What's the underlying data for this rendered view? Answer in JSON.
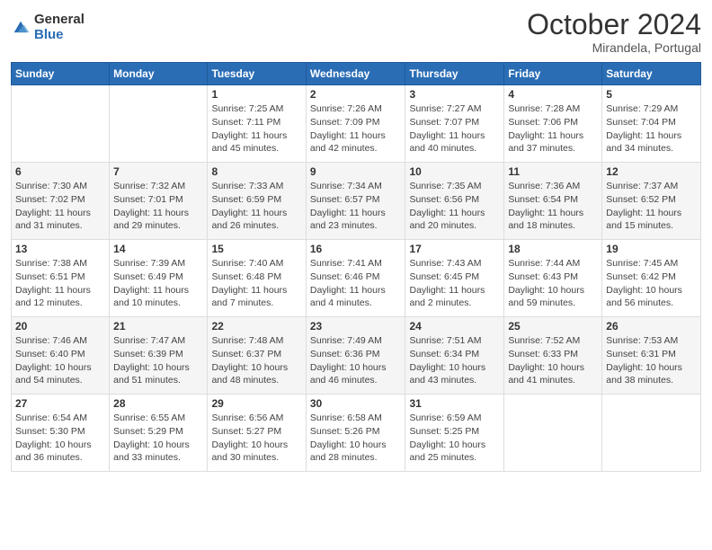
{
  "header": {
    "logo_general": "General",
    "logo_blue": "Blue",
    "month_title": "October 2024",
    "location": "Mirandela, Portugal"
  },
  "days_of_week": [
    "Sunday",
    "Monday",
    "Tuesday",
    "Wednesday",
    "Thursday",
    "Friday",
    "Saturday"
  ],
  "weeks": [
    [
      {
        "day": "",
        "info": ""
      },
      {
        "day": "",
        "info": ""
      },
      {
        "day": "1",
        "info": "Sunrise: 7:25 AM\nSunset: 7:11 PM\nDaylight: 11 hours and 45 minutes."
      },
      {
        "day": "2",
        "info": "Sunrise: 7:26 AM\nSunset: 7:09 PM\nDaylight: 11 hours and 42 minutes."
      },
      {
        "day": "3",
        "info": "Sunrise: 7:27 AM\nSunset: 7:07 PM\nDaylight: 11 hours and 40 minutes."
      },
      {
        "day": "4",
        "info": "Sunrise: 7:28 AM\nSunset: 7:06 PM\nDaylight: 11 hours and 37 minutes."
      },
      {
        "day": "5",
        "info": "Sunrise: 7:29 AM\nSunset: 7:04 PM\nDaylight: 11 hours and 34 minutes."
      }
    ],
    [
      {
        "day": "6",
        "info": "Sunrise: 7:30 AM\nSunset: 7:02 PM\nDaylight: 11 hours and 31 minutes."
      },
      {
        "day": "7",
        "info": "Sunrise: 7:32 AM\nSunset: 7:01 PM\nDaylight: 11 hours and 29 minutes."
      },
      {
        "day": "8",
        "info": "Sunrise: 7:33 AM\nSunset: 6:59 PM\nDaylight: 11 hours and 26 minutes."
      },
      {
        "day": "9",
        "info": "Sunrise: 7:34 AM\nSunset: 6:57 PM\nDaylight: 11 hours and 23 minutes."
      },
      {
        "day": "10",
        "info": "Sunrise: 7:35 AM\nSunset: 6:56 PM\nDaylight: 11 hours and 20 minutes."
      },
      {
        "day": "11",
        "info": "Sunrise: 7:36 AM\nSunset: 6:54 PM\nDaylight: 11 hours and 18 minutes."
      },
      {
        "day": "12",
        "info": "Sunrise: 7:37 AM\nSunset: 6:52 PM\nDaylight: 11 hours and 15 minutes."
      }
    ],
    [
      {
        "day": "13",
        "info": "Sunrise: 7:38 AM\nSunset: 6:51 PM\nDaylight: 11 hours and 12 minutes."
      },
      {
        "day": "14",
        "info": "Sunrise: 7:39 AM\nSunset: 6:49 PM\nDaylight: 11 hours and 10 minutes."
      },
      {
        "day": "15",
        "info": "Sunrise: 7:40 AM\nSunset: 6:48 PM\nDaylight: 11 hours and 7 minutes."
      },
      {
        "day": "16",
        "info": "Sunrise: 7:41 AM\nSunset: 6:46 PM\nDaylight: 11 hours and 4 minutes."
      },
      {
        "day": "17",
        "info": "Sunrise: 7:43 AM\nSunset: 6:45 PM\nDaylight: 11 hours and 2 minutes."
      },
      {
        "day": "18",
        "info": "Sunrise: 7:44 AM\nSunset: 6:43 PM\nDaylight: 10 hours and 59 minutes."
      },
      {
        "day": "19",
        "info": "Sunrise: 7:45 AM\nSunset: 6:42 PM\nDaylight: 10 hours and 56 minutes."
      }
    ],
    [
      {
        "day": "20",
        "info": "Sunrise: 7:46 AM\nSunset: 6:40 PM\nDaylight: 10 hours and 54 minutes."
      },
      {
        "day": "21",
        "info": "Sunrise: 7:47 AM\nSunset: 6:39 PM\nDaylight: 10 hours and 51 minutes."
      },
      {
        "day": "22",
        "info": "Sunrise: 7:48 AM\nSunset: 6:37 PM\nDaylight: 10 hours and 48 minutes."
      },
      {
        "day": "23",
        "info": "Sunrise: 7:49 AM\nSunset: 6:36 PM\nDaylight: 10 hours and 46 minutes."
      },
      {
        "day": "24",
        "info": "Sunrise: 7:51 AM\nSunset: 6:34 PM\nDaylight: 10 hours and 43 minutes."
      },
      {
        "day": "25",
        "info": "Sunrise: 7:52 AM\nSunset: 6:33 PM\nDaylight: 10 hours and 41 minutes."
      },
      {
        "day": "26",
        "info": "Sunrise: 7:53 AM\nSunset: 6:31 PM\nDaylight: 10 hours and 38 minutes."
      }
    ],
    [
      {
        "day": "27",
        "info": "Sunrise: 6:54 AM\nSunset: 5:30 PM\nDaylight: 10 hours and 36 minutes."
      },
      {
        "day": "28",
        "info": "Sunrise: 6:55 AM\nSunset: 5:29 PM\nDaylight: 10 hours and 33 minutes."
      },
      {
        "day": "29",
        "info": "Sunrise: 6:56 AM\nSunset: 5:27 PM\nDaylight: 10 hours and 30 minutes."
      },
      {
        "day": "30",
        "info": "Sunrise: 6:58 AM\nSunset: 5:26 PM\nDaylight: 10 hours and 28 minutes."
      },
      {
        "day": "31",
        "info": "Sunrise: 6:59 AM\nSunset: 5:25 PM\nDaylight: 10 hours and 25 minutes."
      },
      {
        "day": "",
        "info": ""
      },
      {
        "day": "",
        "info": ""
      }
    ]
  ]
}
